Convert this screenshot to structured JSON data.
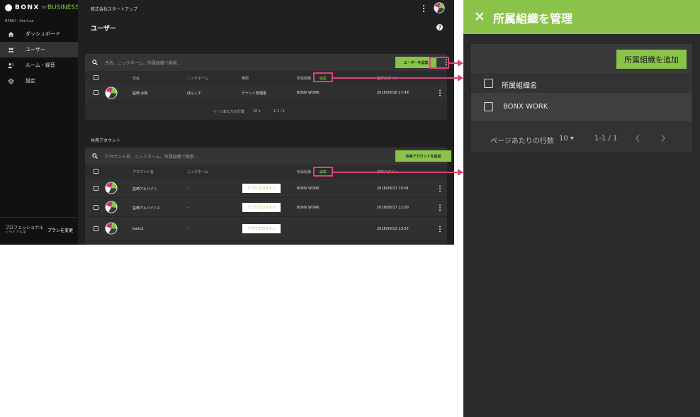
{
  "app": {
    "logo": {
      "brand": "BONX",
      "for": "for",
      "business": "BUSINESS"
    },
    "org_code": "B4BID : Start-up",
    "company": "株式会社スタートアップ",
    "page_title": "ユーザー",
    "nav": [
      {
        "label": "ダッシュボード",
        "icon": "home-icon"
      },
      {
        "label": "ユーザー",
        "icon": "people-icon",
        "active": true
      },
      {
        "label": "ルーム・録音",
        "icon": "room-record-icon"
      },
      {
        "label": "設定",
        "icon": "gear-icon"
      }
    ],
    "plan": {
      "name": "プロフェッショナル",
      "trial": "トライアル中",
      "change": "プランを変更"
    },
    "users": {
      "search_placeholder": "氏名、ニックネーム、所属組織で検索...",
      "add_button": "ユーザーを追加",
      "columns": {
        "name": "氏名",
        "nickname": "ニックネーム",
        "role": "権限",
        "org": "所属組織",
        "edit": "編集",
        "login": "最終ログイン"
      },
      "rows": [
        {
          "name": "益崎 太郎",
          "nickname": "ぽんくす",
          "role": "テナント管理者",
          "org": "BONX WORK",
          "date": "2018/08/16 17:48"
        }
      ],
      "pager": {
        "rows_label": "ページあたりの行数",
        "rows_value": "10",
        "range": "1-1 / 1"
      }
    },
    "shared": {
      "section_label": "共用アカウント",
      "search_placeholder": "アカウント名、ニックネーム、所属組織で検索...",
      "add_button": "共用アカウントを追加",
      "columns": {
        "account": "アカウント名",
        "nickname": "ニックネーム",
        "org": "所属組織",
        "edit": "編集",
        "login": "最終ログイン"
      },
      "rows": [
        {
          "account": "益崎アルバイト",
          "nickname": "-",
          "login_button": "アプリでログイン",
          "org": "BONX WORK",
          "date": "2018/08/17 10:04"
        },
        {
          "account": "益崎アルバイト2",
          "nickname": "-",
          "login_button": "アプリでログイン",
          "org": "BONX WORK",
          "date": "2018/08/17 11:00"
        },
        {
          "account": "baito1",
          "nickname": "-",
          "login_button": "アプリでログイン",
          "org": "",
          "date": "2018/09/12 13:55"
        }
      ]
    }
  },
  "drawer": {
    "title": "所属組織を管理",
    "add_button": "所属組織を追加",
    "column": "所属組織名",
    "rows": [
      {
        "name": "BONX WORK"
      }
    ],
    "pager": {
      "rows_label": "ページあたりの行数",
      "rows_value": "10",
      "range": "1-1 / 1"
    }
  },
  "colors": {
    "accent": "#8bc34a",
    "highlight": "#d8457a",
    "sidebar": "#111111",
    "drawer_bg": "#2a2a2a"
  }
}
